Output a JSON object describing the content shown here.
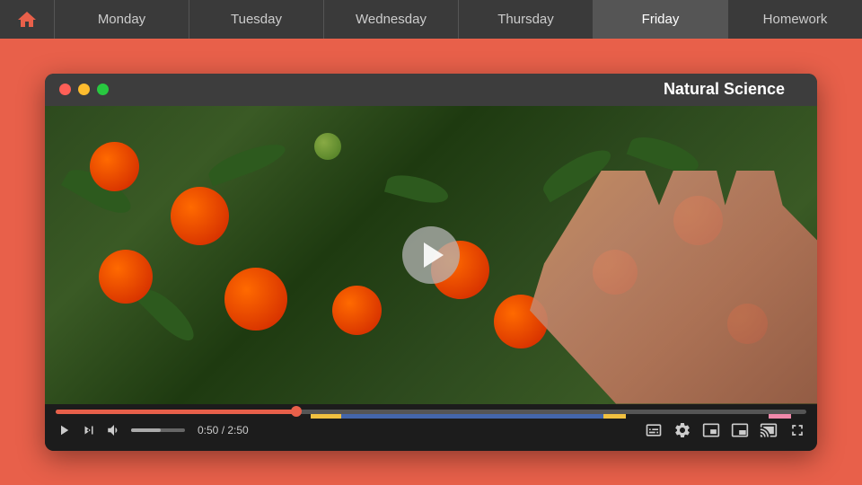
{
  "nav": {
    "home_label": "Home",
    "tabs": [
      {
        "id": "monday",
        "label": "Monday",
        "active": false
      },
      {
        "id": "tuesday",
        "label": "Tuesday",
        "active": false
      },
      {
        "id": "wednesday",
        "label": "Wednesday",
        "active": false
      },
      {
        "id": "thursday",
        "label": "Thursday",
        "active": false
      },
      {
        "id": "friday",
        "label": "Friday",
        "active": true
      },
      {
        "id": "homework",
        "label": "Homework",
        "active": false
      }
    ]
  },
  "video_window": {
    "title": "Natural Science",
    "btn_close": "close",
    "btn_min": "minimize",
    "btn_max": "maximize",
    "time_current": "0:50",
    "time_total": "2:50",
    "time_display": "0:50 / 2:50"
  }
}
